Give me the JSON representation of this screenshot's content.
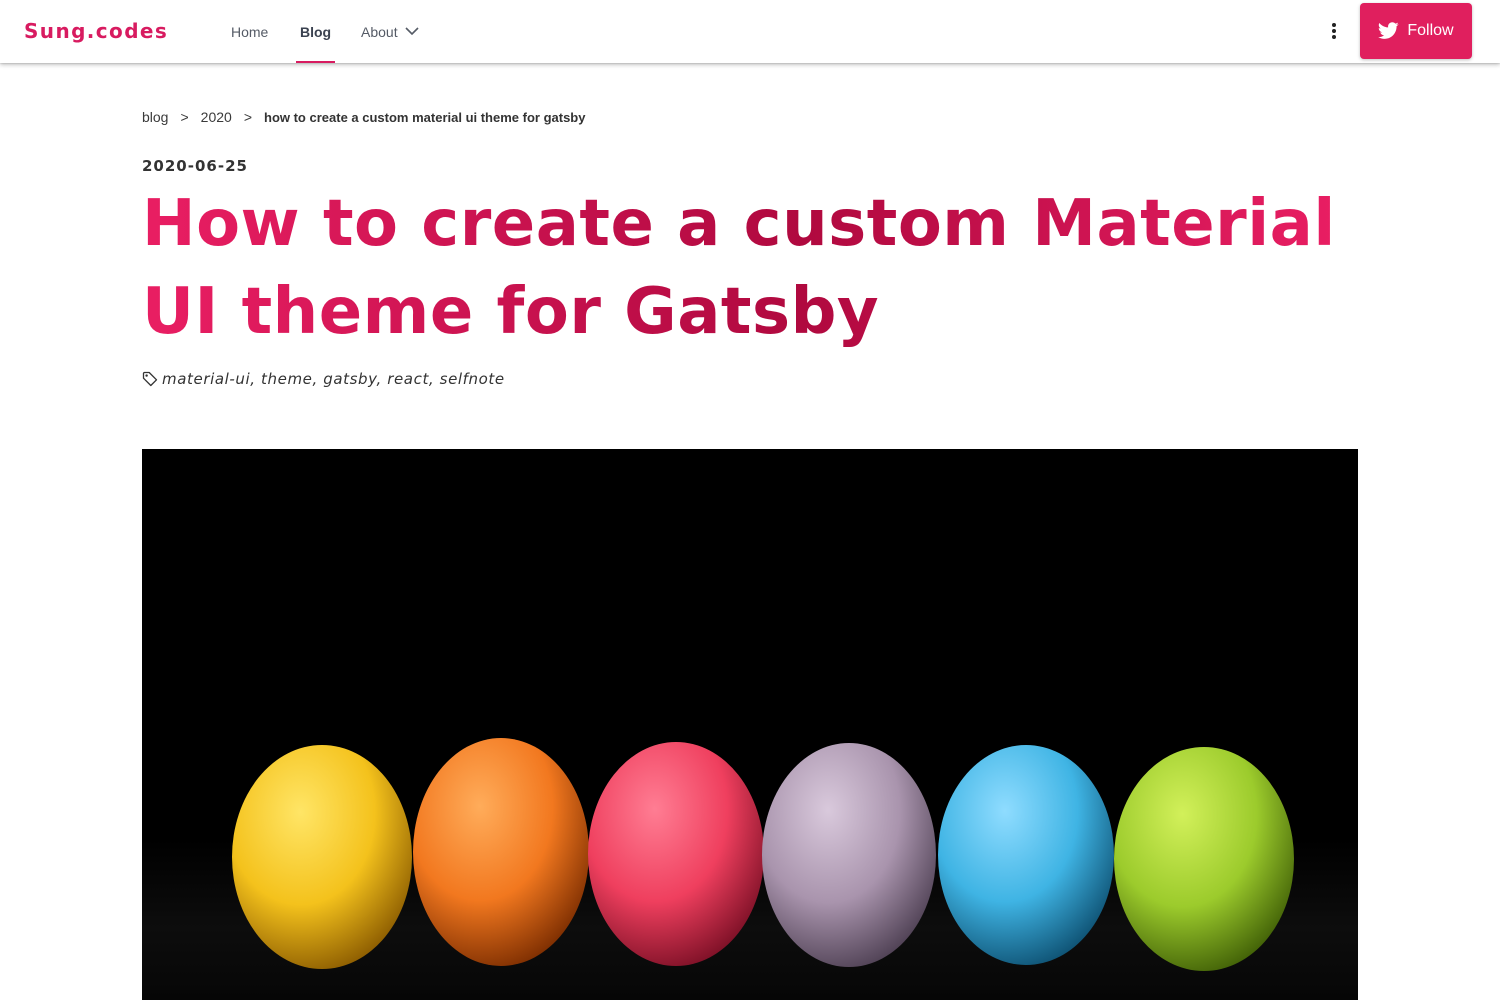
{
  "header": {
    "brand": "Sung.codes",
    "nav": {
      "home": "Home",
      "blog": "Blog",
      "about": "About"
    },
    "follow_label": "Follow",
    "accent_color": "#e01f5e"
  },
  "breadcrumb": {
    "blog": "blog",
    "separator": ">",
    "year": "2020",
    "current": "how to create a custom material ui theme for gatsby"
  },
  "post": {
    "date": "2020-06-25",
    "title": "How to create a custom Material UI theme for Gatsby",
    "tags": "material-ui, theme, gatsby, react, selfnote",
    "title_color": "#d81b60"
  },
  "icons": {
    "about_dropdown": "chevron-down-icon",
    "more": "more-vert-icon",
    "follow": "twitter-bird-icon",
    "tags": "tag-icon"
  },
  "hero": {
    "background": "#000000",
    "egg_colors": [
      "#f4c21c",
      "#f2781f",
      "#ef3f5e",
      "#a994ad",
      "#3fb4e4",
      "#9ccb2c"
    ]
  }
}
